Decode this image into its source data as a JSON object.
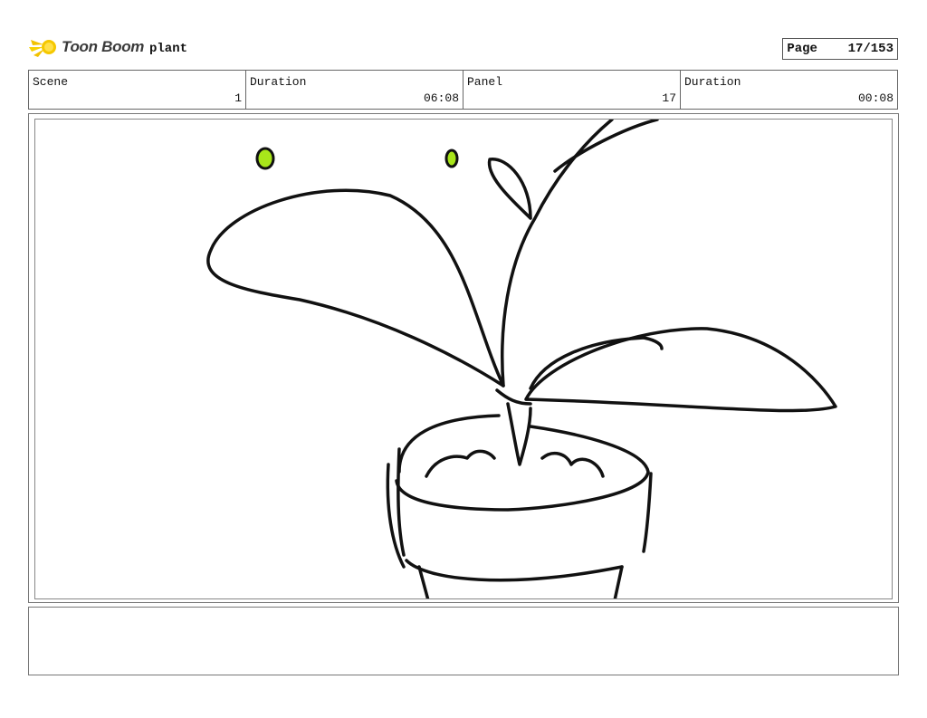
{
  "header": {
    "logo_text": "Toon Boom",
    "project_name": "plant",
    "page_label": "Page",
    "page_number": "17/153"
  },
  "info": {
    "scene_label": "Scene",
    "scene_value": "1",
    "scene_duration_label": "Duration",
    "scene_duration_value": "06:08",
    "panel_label": "Panel",
    "panel_value": "17",
    "panel_duration_label": "Duration",
    "panel_duration_value": "00:08"
  },
  "colors": {
    "logo_accent": "#f2c200",
    "eye_color": "#a8e61a",
    "line_color": "#111111"
  },
  "notes": {
    "text": ""
  }
}
